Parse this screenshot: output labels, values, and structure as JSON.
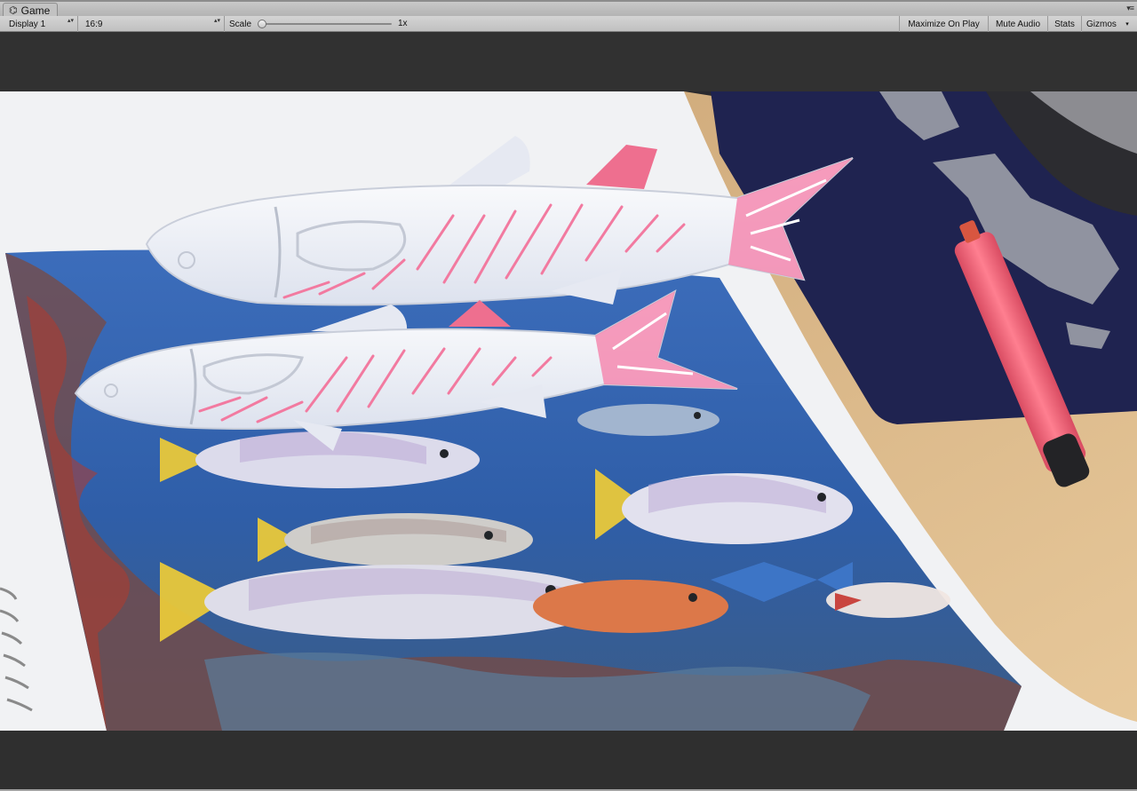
{
  "window": {
    "tab_icon": "unity-game-icon",
    "tab_label": "Game",
    "panel_menu_glyph": "▾≡"
  },
  "toolbar": {
    "display": "Display 1",
    "aspect": "16:9",
    "scale_label": "Scale",
    "scale_value": "1x",
    "scale_fraction": 0.0,
    "maximize_on_play": "Maximize On Play",
    "mute_audio": "Mute Audio",
    "stats": "Stats",
    "gizmos": "Gizmos",
    "dropdown_arrow": "▴▾",
    "gizmos_arrow": "▾"
  },
  "colors": {
    "background": "#313131",
    "toolbar": "#c8c8c8",
    "fish_stripe": "#f27aa0",
    "fish_body": "#f3f5fb",
    "marker": "#f06a7c",
    "mousepad": "#1f2350",
    "desk": "#d8b88a"
  }
}
